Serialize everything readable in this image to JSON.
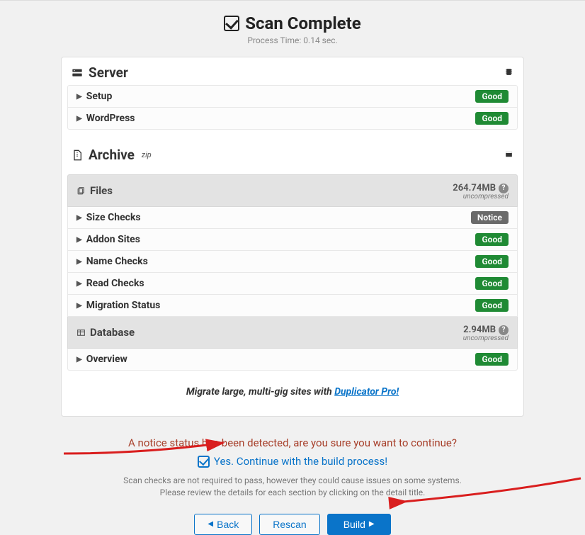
{
  "header": {
    "title": "Scan Complete",
    "subtitle": "Process Time: 0.14 sec."
  },
  "server": {
    "title": "Server",
    "rows": {
      "setup": {
        "label": "Setup",
        "badge": "Good"
      },
      "wordpress": {
        "label": "WordPress",
        "badge": "Good"
      }
    }
  },
  "archive": {
    "title": "Archive",
    "suffix": "zip",
    "files": {
      "title": "Files",
      "size": "264.74MB",
      "uncompressed": "uncompressed",
      "rows": {
        "size_checks": {
          "label": "Size Checks",
          "badge": "Notice"
        },
        "addon_sites": {
          "label": "Addon Sites",
          "badge": "Good"
        },
        "name_checks": {
          "label": "Name Checks",
          "badge": "Good"
        },
        "read_checks": {
          "label": "Read Checks",
          "badge": "Good"
        },
        "migration_status": {
          "label": "Migration Status",
          "badge": "Good"
        }
      }
    },
    "database": {
      "title": "Database",
      "size": "2.94MB",
      "uncompressed": "uncompressed",
      "rows": {
        "overview": {
          "label": "Overview",
          "badge": "Good"
        }
      }
    }
  },
  "promo": {
    "text": "Migrate large, multi-gig sites with ",
    "link_text": "Duplicator Pro!"
  },
  "notice": {
    "warning": "A notice status has been detected, are you sure you want to continue?",
    "continue_label": "Yes. Continue with the build process!",
    "checked": true,
    "help_line1": "Scan checks are not required to pass, however they could cause issues on some systems.",
    "help_line2": "Please review the details for each section by clicking on the detail title."
  },
  "buttons": {
    "back": "Back",
    "rescan": "Rescan",
    "build": "Build"
  }
}
